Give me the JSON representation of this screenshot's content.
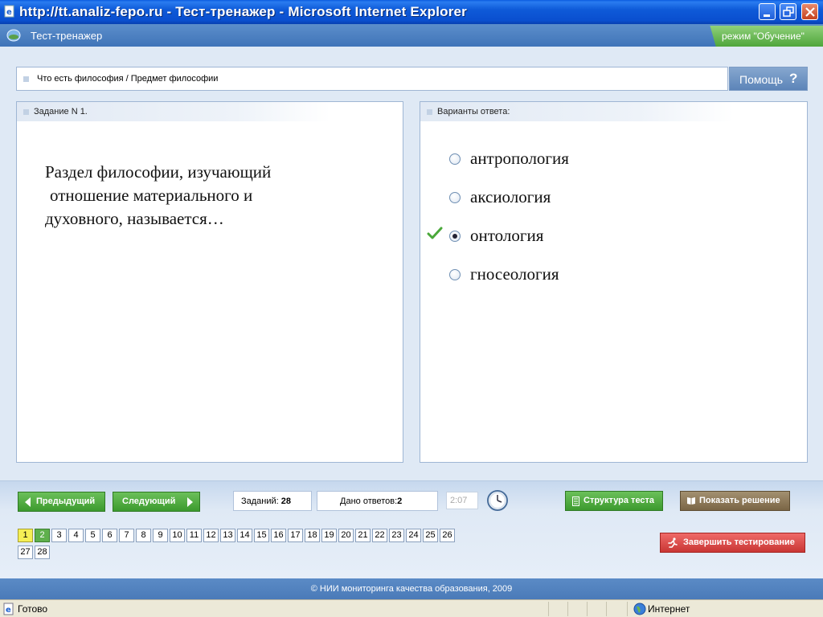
{
  "window": {
    "title": "http://tt.analiz-fepo.ru - Тест-тренажер - Microsoft Internet Explorer"
  },
  "app": {
    "title": "Тест-тренажер",
    "mode": "режим \"Обучение\""
  },
  "topic": {
    "text": "Что есть философия / Предмет философии"
  },
  "help": {
    "label": "Помощь",
    "icon_text": "?"
  },
  "task": {
    "header": "Задание N 1.",
    "question_line1": "Раздел философии, изучающий",
    "question_line2": "отношение материального и",
    "question_line3": "духовного, называется…"
  },
  "answers": {
    "header": "Варианты ответа:",
    "options": [
      {
        "label": "антропология",
        "selected": false
      },
      {
        "label": "аксиология",
        "selected": false
      },
      {
        "label": "онтология",
        "selected": true
      },
      {
        "label": "гносеология",
        "selected": false
      }
    ]
  },
  "controls": {
    "prev_label": "Предыдущий",
    "next_label": "Следующий",
    "tasks_label": "Заданий:",
    "tasks_count": "28",
    "answered_label": "Дано ответов:",
    "answered_count": "2",
    "timer": "2:07",
    "structure_label": "Структура теста",
    "solution_label": "Показать решение",
    "finish_label": "Завершить тестирование"
  },
  "pager": {
    "pages": [
      "1",
      "2",
      "3",
      "4",
      "5",
      "6",
      "7",
      "8",
      "9",
      "10",
      "11",
      "12",
      "13",
      "14",
      "15",
      "16",
      "17",
      "18",
      "19",
      "20",
      "21",
      "22",
      "23",
      "24",
      "25",
      "26",
      "27",
      "28"
    ],
    "current": "1",
    "answered": [
      "2"
    ]
  },
  "footer": {
    "copyright": "© НИИ мониторинга качества образования, 2009"
  },
  "statusbar": {
    "left": "Готово",
    "right": "Интернет"
  },
  "colors": {
    "titlebar": "#0a4fcf",
    "appbar": "#4a7ab8",
    "green_button": "#3c9a2e",
    "brown_button": "#7a6545",
    "red_button": "#c93634",
    "current_page": "#f5ef55",
    "answered_page": "#5fb04c"
  },
  "icons": {
    "app_icon": "ie-page-icon",
    "minimize": "minimize-icon",
    "maximize": "restore-icon",
    "close": "close-icon",
    "check": "checkmark-icon",
    "clock": "clock-icon",
    "globe": "globe-icon"
  }
}
